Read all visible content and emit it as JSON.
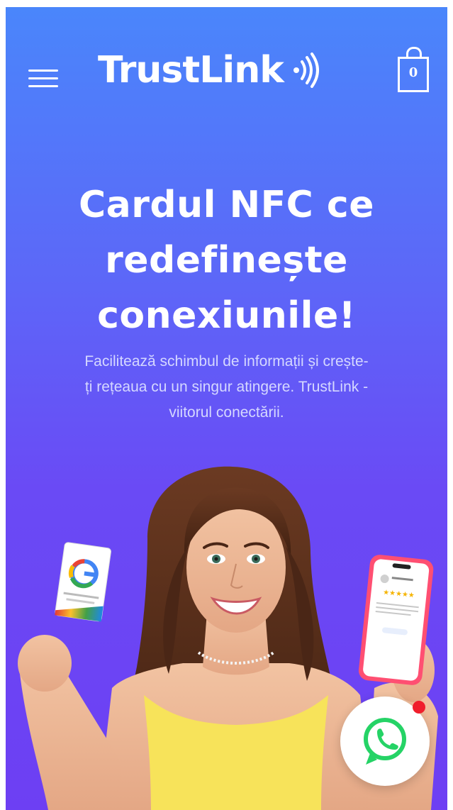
{
  "header": {
    "logo_text": "TrustLink",
    "cart_count": "0"
  },
  "hero": {
    "headline_line1": "Cardul NFC ce",
    "headline_line2": "redefinește",
    "headline_line3": "conexiunile!",
    "subtext_line1": "Facilitează schimbul de informații și crește-",
    "subtext_line2": "ți rețeaua cu un singur atingere. TrustLink -",
    "subtext_line3": "viitorul conectării."
  },
  "icons": {
    "menu": "hamburger-menu-icon",
    "logo_mark": "nfc-waves-icon",
    "cart": "shopping-bag-icon",
    "chat": "whatsapp-icon"
  },
  "colors": {
    "gradient_top": "#4a86fb",
    "gradient_bottom": "#6d3ff3",
    "whatsapp_green": "#25d366",
    "notification_red": "#f01e2c"
  }
}
